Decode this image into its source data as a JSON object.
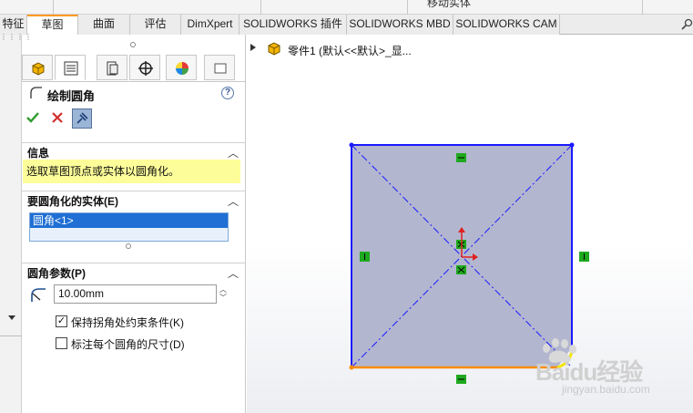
{
  "toolbar": {
    "move_body_label": "移动实体"
  },
  "tabs": [
    {
      "label": "特征",
      "active": false
    },
    {
      "label": "草图",
      "active": true
    },
    {
      "label": "曲面",
      "active": false
    },
    {
      "label": "评估",
      "active": false
    },
    {
      "label": "DimXpert",
      "active": false
    },
    {
      "label": "SOLIDWORKS 插件",
      "active": false
    },
    {
      "label": "SOLIDWORKS MBD",
      "active": false
    },
    {
      "label": "SOLIDWORKS CAM",
      "active": false
    }
  ],
  "panel": {
    "title": "绘制圆角",
    "help_label": "?",
    "info_section": {
      "header": "信息",
      "message": "选取草图顶点或实体以圆角化。"
    },
    "entities_section": {
      "header": "要圆角化的实体(E)",
      "items": [
        "圆角<1>"
      ]
    },
    "params_section": {
      "header": "圆角参数(P)",
      "radius_value": "10.00mm",
      "keep_constraints_label": "保持拐角处约束条件(K)",
      "keep_constraints_checked": true,
      "dimension_each_label": "标注每个圆角的尺寸(D)",
      "dimension_each_checked": false
    }
  },
  "tree": {
    "root_label": "零件1 (默认<<默认>_显..."
  },
  "watermark": {
    "brand": "Baidu经验",
    "url": "jingyan.baidu.com"
  },
  "colors": {
    "accent_orange": "#ff9a1f",
    "sketch_blue": "#1a1aff",
    "selection_blue": "#1f6fd4",
    "info_yellow": "#fdfd9a",
    "fill_region": "#b3b6cf"
  }
}
